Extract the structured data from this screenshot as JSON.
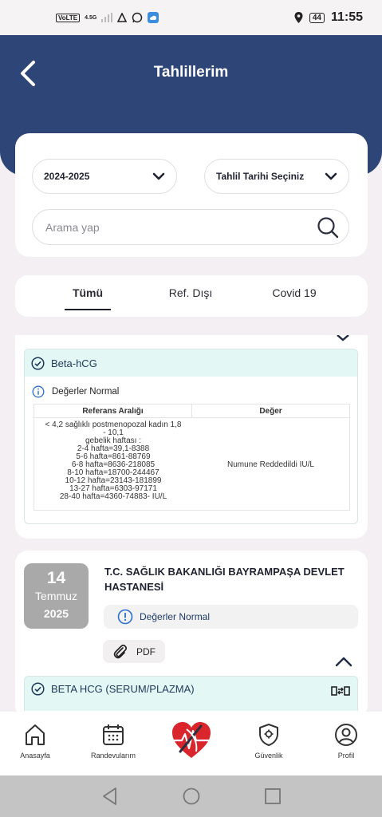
{
  "status_bar": {
    "volte": "VoLTE",
    "network": "4.5G",
    "battery": "44",
    "time": "11:55"
  },
  "header": {
    "title": "Tahlillerim"
  },
  "filters": {
    "year": "2024-2025",
    "date_select": "Tahlil Tarihi Seçiniz",
    "search_placeholder": "Arama yap"
  },
  "tabs": [
    {
      "label": "Tümü",
      "active": true
    },
    {
      "label": "Ref. Dışı",
      "active": false
    },
    {
      "label": "Covid 19",
      "active": false
    }
  ],
  "result1": {
    "test_name": "Beta-hCG",
    "status": "Değerler Normal",
    "table": {
      "col_ref": "Referans Aralığı",
      "col_value": "Değer",
      "ref_lines": [
        "< 4,2 sağlıklı postmenopozal kadın 1,8",
        "- 10,1",
        "gebelik haftası :",
        "2-4 hafta=39,1-8388",
        "5-6 hafta=861-88769",
        "6-8 hafta=8636-218085",
        "8-10 hafta=18700-244467",
        "10-12 hafta=23143-181899",
        "13-27 hafta=6303-97171",
        "28-40 hafta=4360-74883- IU/L"
      ],
      "value": "Numune Reddedildi IU/L"
    }
  },
  "result2": {
    "date": {
      "day": "14",
      "month": "Temmuz",
      "year": "2025"
    },
    "hospital": "T.C. SAĞLIK BAKANLIĞI BAYRAMPAŞA DEVLET HASTANESİ",
    "status": "Değerler Normal",
    "pdf_label": "PDF",
    "test_name": "BETA HCG (SERUM/PLAZMA)"
  },
  "bottom_nav": [
    {
      "label": "Anasayfa",
      "icon": "home-icon"
    },
    {
      "label": "Randevularım",
      "icon": "calendar-icon"
    },
    {
      "label": "",
      "icon": "heart-logo-icon"
    },
    {
      "label": "Güvenlik",
      "icon": "shield-icon"
    },
    {
      "label": "Profil",
      "icon": "user-icon"
    }
  ],
  "colors": {
    "header": "#2e4578",
    "accent_teal": "#e3f7f5",
    "date_badge": "#a9a9a9",
    "heart_red": "#d9252b"
  }
}
